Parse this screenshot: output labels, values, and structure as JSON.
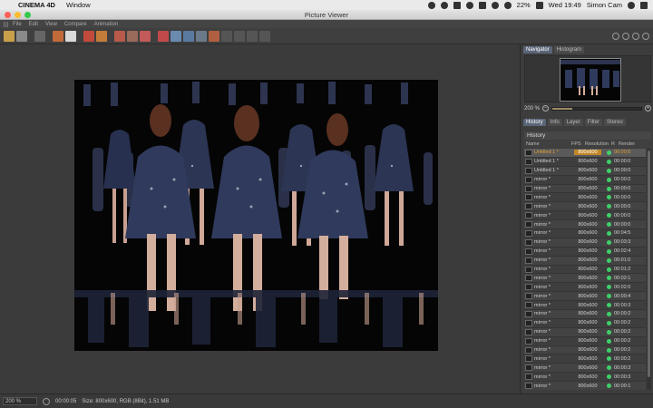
{
  "menubar": {
    "app_name": "CINEMA 4D",
    "menu_window": "Window",
    "battery": "22%",
    "clock": "Wed 19:49",
    "user": "Simon Cam"
  },
  "window": {
    "title": "Picture Viewer"
  },
  "app_menu": [
    "File",
    "Edit",
    "View",
    "Compare",
    "Animation"
  ],
  "navigator": {
    "tabs": [
      "Navigator",
      "Histogram"
    ],
    "zoom": "200 %",
    "zoom_fraction": 0.22
  },
  "history_panel": {
    "tabs": [
      "History",
      "Info",
      "Layer",
      "Filter",
      "Stereo"
    ],
    "header": "History",
    "columns": {
      "name": "Name",
      "fps": "FPS",
      "resolution": "Resolution",
      "r": "R",
      "render": "Render"
    },
    "rows": [
      {
        "name": "Untitled 1 *",
        "resolution": "800x600",
        "render": "00:00:0",
        "highlight": true
      },
      {
        "name": "Untitled 1 *",
        "resolution": "800x600",
        "render": "00:00:0",
        "highlight": false
      },
      {
        "name": "Untitled 1 *",
        "resolution": "800x600",
        "render": "00:00:0",
        "highlight": false
      },
      {
        "name": "mirror *",
        "resolution": "800x600",
        "render": "00:00:0",
        "highlight": false
      },
      {
        "name": "mirror *",
        "resolution": "800x600",
        "render": "00:00:0",
        "highlight": false
      },
      {
        "name": "mirror *",
        "resolution": "800x600",
        "render": "00:00:0",
        "highlight": false
      },
      {
        "name": "mirror *",
        "resolution": "800x600",
        "render": "00:00:0",
        "highlight": false
      },
      {
        "name": "mirror *",
        "resolution": "800x600",
        "render": "00:00:0",
        "highlight": false
      },
      {
        "name": "mirror *",
        "resolution": "800x600",
        "render": "00:00:0",
        "highlight": false
      },
      {
        "name": "mirror *",
        "resolution": "800x600",
        "render": "00:04:5",
        "highlight": false
      },
      {
        "name": "mirror *",
        "resolution": "800x600",
        "render": "00:03:3",
        "highlight": false
      },
      {
        "name": "mirror *",
        "resolution": "800x600",
        "render": "00:02:4",
        "highlight": false
      },
      {
        "name": "mirror *",
        "resolution": "800x600",
        "render": "00:01:0",
        "highlight": false
      },
      {
        "name": "mirror *",
        "resolution": "800x600",
        "render": "00:01:2",
        "highlight": false
      },
      {
        "name": "mirror *",
        "resolution": "800x600",
        "render": "00:02:1",
        "highlight": false
      },
      {
        "name": "mirror *",
        "resolution": "800x600",
        "render": "00:02:0",
        "highlight": false
      },
      {
        "name": "mirror *",
        "resolution": "800x600",
        "render": "00:00:4",
        "highlight": false
      },
      {
        "name": "mirror *",
        "resolution": "800x600",
        "render": "00:00:3",
        "highlight": false
      },
      {
        "name": "mirror *",
        "resolution": "800x600",
        "render": "00:00:2",
        "highlight": false
      },
      {
        "name": "mirror *",
        "resolution": "800x600",
        "render": "00:00:2",
        "highlight": false
      },
      {
        "name": "mirror *",
        "resolution": "800x600",
        "render": "00:00:2",
        "highlight": false
      },
      {
        "name": "mirror *",
        "resolution": "800x600",
        "render": "00:00:2",
        "highlight": false
      },
      {
        "name": "mirror *",
        "resolution": "800x600",
        "render": "00:00:2",
        "highlight": false
      },
      {
        "name": "mirror *",
        "resolution": "800x600",
        "render": "00:00:2",
        "highlight": false
      },
      {
        "name": "mirror *",
        "resolution": "800x600",
        "render": "00:00:3",
        "highlight": false
      },
      {
        "name": "mirror *",
        "resolution": "800x600",
        "render": "00:00:3",
        "highlight": false
      },
      {
        "name": "mirror *",
        "resolution": "800x600",
        "render": "00:00:1",
        "highlight": false
      }
    ]
  },
  "status": {
    "zoom": "200 %",
    "time": "00:00:05",
    "info": "Size: 800x600, RGB (8Bit), 1.51 MB"
  },
  "colors": {
    "accent_orange": "#c08828",
    "status_green": "#3fd06a",
    "panel_bg": "#3d3d3d"
  }
}
